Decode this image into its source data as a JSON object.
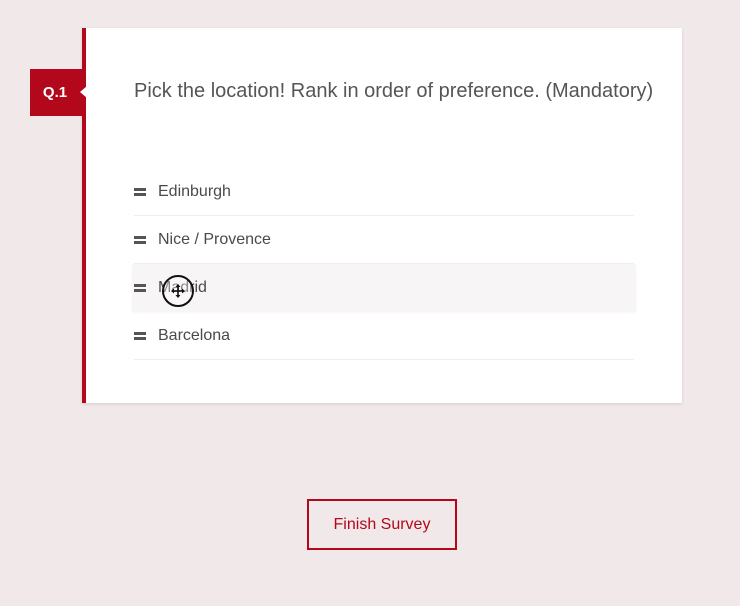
{
  "question": {
    "number": "Q.1",
    "text": "Pick the location! Rank in order of preference. (Mandatory)"
  },
  "rank_items": [
    {
      "label": "Edinburgh"
    },
    {
      "label": "Nice / Provence"
    },
    {
      "label": "Madrid"
    },
    {
      "label": "Barcelona"
    }
  ],
  "dragging_item_index": 2,
  "cursor": {
    "icon": "move-cursor-icon"
  },
  "footer": {
    "finish_label": "Finish Survey"
  },
  "colors": {
    "accent": "#b3071b",
    "background": "#f1e9e9",
    "card": "#ffffff"
  }
}
